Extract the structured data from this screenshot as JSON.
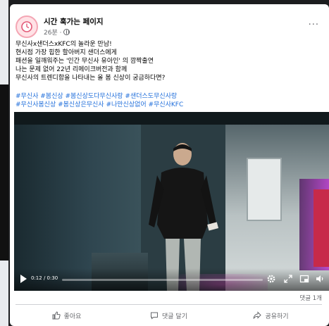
{
  "post": {
    "page_name": "시간 훅가는 페이지",
    "time_ago": "26분 · ",
    "more_label": "···",
    "text_lines": [
      "무신사x샌더스xKFC의 놀라운 만남!",
      "현시점 가장 힙한 할아버지 샌더스에게",
      "패션을 일깨워주는 '인간 무신사 유아인' 의 깜짝출연",
      "나는 문제 없어 22년 리메이크버전과 함께",
      "무신사의 트렌디함을 나타내는 올 봄 신상이 궁금하다면?"
    ],
    "hashtag_lines": [
      "#무신사 #봄신상 #봄신상도다무신사랑 #샌더스도무신사랑",
      "#무신사봄신상 #봄신상은무신사 #나만신상없어 #무신사KFC"
    ]
  },
  "video": {
    "time": "0:12 / 0:30",
    "progress": 0.0,
    "icons": [
      "play-icon",
      "settings-icon",
      "expand-icon",
      "pip-icon",
      "volume-icon"
    ]
  },
  "engagement": {
    "comment_count": "댓글 1개"
  },
  "actions": {
    "like": "좋아요",
    "comment": "댓글 달기",
    "share": "공유하기"
  },
  "colors": {
    "hashtag": "#216fdb",
    "secondary_text": "#65676b",
    "card_bg": "#ffffff"
  }
}
